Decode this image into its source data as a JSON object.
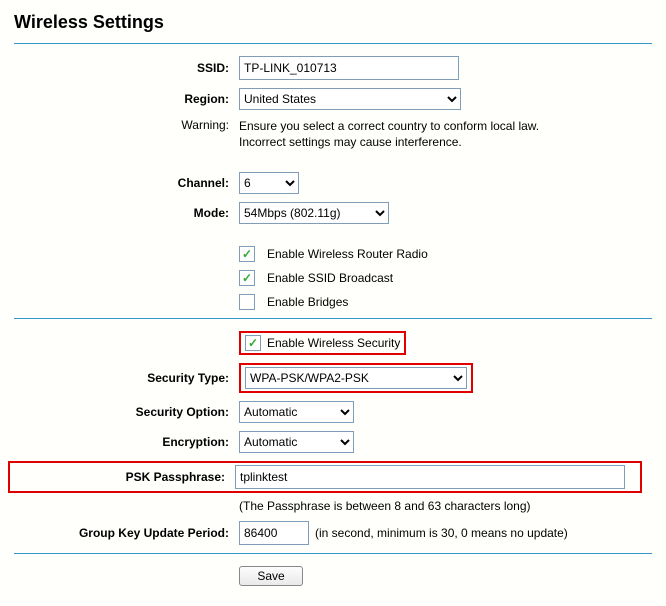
{
  "page": {
    "title": "Wireless Settings"
  },
  "labels": {
    "ssid": "SSID:",
    "region": "Region:",
    "warning": "Warning:",
    "channel": "Channel:",
    "mode": "Mode:",
    "enable_radio": "Enable Wireless Router Radio",
    "enable_ssid": "Enable SSID Broadcast",
    "enable_bridges": "Enable Bridges",
    "enable_security": "Enable Wireless Security",
    "security_type": "Security Type:",
    "security_option": "Security Option:",
    "encryption": "Encryption:",
    "psk": "PSK Passphrase:",
    "psk_note": "(The Passphrase is between 8 and 63 characters long)",
    "gkup": "Group Key Update Period:",
    "gkup_note": "(in second, minimum is 30, 0 means no update)",
    "save": "Save"
  },
  "values": {
    "ssid": "TP-LINK_010713",
    "region": "United States",
    "channel": "6",
    "mode": "54Mbps (802.11g)",
    "security_type": "WPA-PSK/WPA2-PSK",
    "security_option": "Automatic",
    "encryption": "Automatic",
    "psk": "tplinktest",
    "gkup": "86400"
  },
  "warning_text": "Ensure you select a correct country to conform local law.\nIncorrect settings may cause interference.",
  "checks": {
    "radio": "✓",
    "ssid": "✓",
    "bridges": "",
    "security": "✓"
  }
}
